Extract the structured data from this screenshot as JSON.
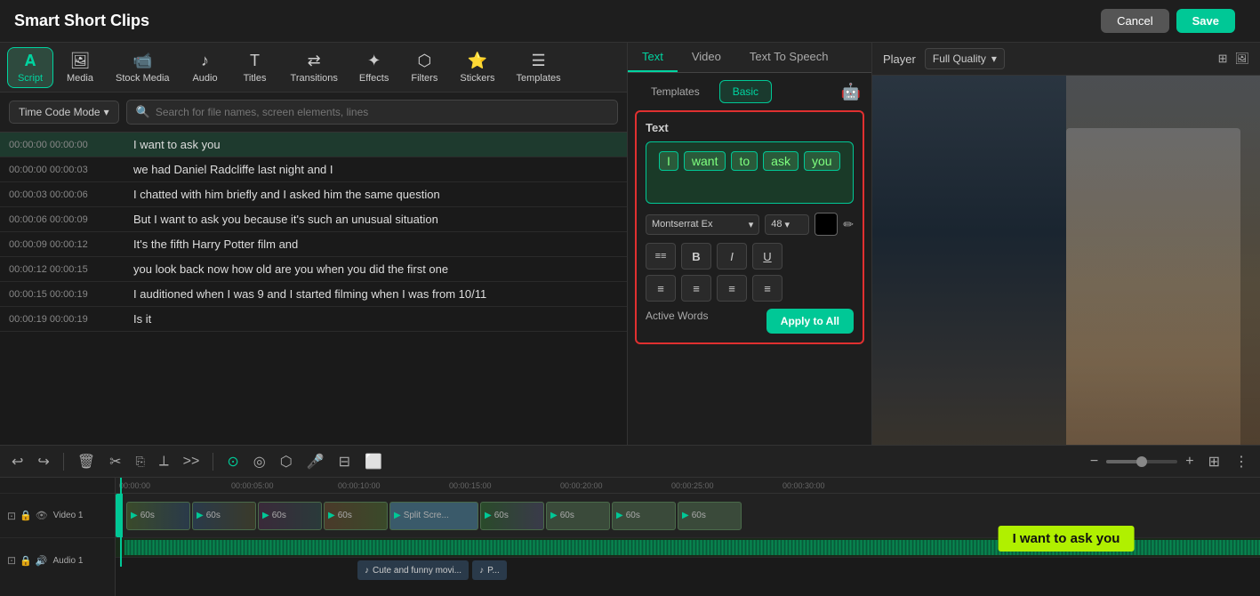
{
  "app": {
    "title": "Smart Short Clips",
    "cancel_label": "Cancel",
    "save_label": "Save"
  },
  "toolbar": {
    "items": [
      {
        "id": "script",
        "label": "Script",
        "icon": "A",
        "active": true
      },
      {
        "id": "media",
        "label": "Media",
        "icon": "🖼"
      },
      {
        "id": "stock",
        "label": "Stock Media",
        "icon": "🎬"
      },
      {
        "id": "audio",
        "label": "Audio",
        "icon": "🎵"
      },
      {
        "id": "titles",
        "label": "Titles",
        "icon": "T"
      },
      {
        "id": "transitions",
        "label": "Transitions",
        "icon": "↔"
      },
      {
        "id": "effects",
        "label": "Effects",
        "icon": "✨"
      },
      {
        "id": "filters",
        "label": "Filters",
        "icon": "⬡"
      },
      {
        "id": "stickers",
        "label": "Stickers",
        "icon": "⭐"
      },
      {
        "id": "templates",
        "label": "Templates",
        "icon": "☰"
      }
    ]
  },
  "script_controls": {
    "timecode_mode": "Time Code Mode",
    "search_placeholder": "Search for file names, screen elements, lines"
  },
  "script_lines": [
    {
      "start": "00:00:00",
      "end": "00:00:00",
      "text": "I want to ask you",
      "active": true
    },
    {
      "start": "00:00:00",
      "end": "00:00:03",
      "text": "we had Daniel Radcliffe last night and I"
    },
    {
      "start": "00:00:03",
      "end": "00:00:06",
      "text": "I chatted with him briefly and I asked him the same question"
    },
    {
      "start": "00:00:06",
      "end": "00:00:09",
      "text": "But I want to ask you because it's such an unusual situation"
    },
    {
      "start": "00:00:09",
      "end": "00:00:12",
      "text": "It's the fifth Harry Potter film and"
    },
    {
      "start": "00:00:12",
      "end": "00:00:15",
      "text": "you look back now how old are you when you did the first one"
    },
    {
      "start": "00:00:15",
      "end": "00:00:19",
      "text": "I auditioned when I was 9 and I started filming when I was from 10/11"
    },
    {
      "start": "00:00:19",
      "end": "00:00:19",
      "text": "Is it"
    }
  ],
  "top_tabs": [
    {
      "id": "text",
      "label": "Text",
      "active": true
    },
    {
      "id": "video",
      "label": "Video"
    },
    {
      "id": "tts",
      "label": "Text To Speech"
    }
  ],
  "sub_tabs": [
    {
      "id": "templates",
      "label": "Templates"
    },
    {
      "id": "basic",
      "label": "Basic",
      "active": true
    }
  ],
  "text_panel": {
    "section_label": "Text",
    "words": [
      "I",
      "want",
      "to",
      "ask",
      "you"
    ],
    "font": "Montserrat Ex",
    "font_size": "48",
    "bold": false,
    "italic": false,
    "underline": false,
    "active_words_label": "Active Words",
    "apply_all_label": "Apply to All"
  },
  "player": {
    "label": "Player",
    "quality": "Full Quality"
  },
  "subtitle": {
    "text": "I want to ask you"
  },
  "timeline": {
    "time_marks": [
      "00:00:00",
      "00:00:05:00",
      "00:00:10:00",
      "00:00:15:00",
      "00:00:20:00",
      "00:00:25:00",
      "00:00:30:00"
    ],
    "tracks": [
      {
        "id": "video1",
        "name": "Video 1"
      },
      {
        "id": "audio1",
        "name": "Audio 1"
      }
    ],
    "video_clips": [
      "60s",
      "60s",
      "60s",
      "60s",
      "Split Scre...",
      "60s",
      "60s",
      "60s",
      "60s"
    ],
    "audio_clips": [
      "Cute and funny movi...",
      "P..."
    ]
  }
}
